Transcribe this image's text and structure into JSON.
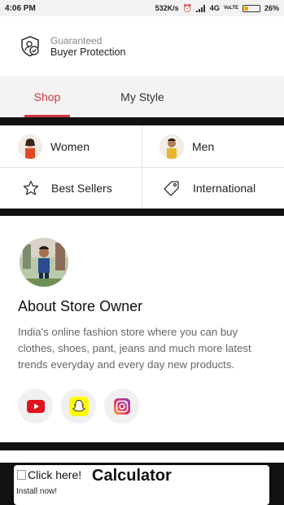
{
  "statusbar": {
    "time": "4:06 PM",
    "speed": "532K/s",
    "network": "4G",
    "volte": "VoLTE",
    "battery": "26%",
    "battery_level": 0.26
  },
  "protection": {
    "line1": "Guaranteed",
    "line2": "Buyer Protection"
  },
  "tabs": [
    {
      "label": "Shop",
      "active": true
    },
    {
      "label": "My Style",
      "active": false
    }
  ],
  "categories": {
    "women": "Women",
    "men": "Men",
    "best_sellers": "Best Sellers",
    "international": "International"
  },
  "about": {
    "title": "About Store Owner",
    "description": "India's online fashion store where you can buy clothes, shoes, pant, jeans and much more latest trends everyday and every day new products."
  },
  "socials": [
    {
      "icon": "youtube-icon",
      "color": "#e0121b"
    },
    {
      "icon": "snapchat-icon",
      "color": "#fffc00"
    },
    {
      "icon": "instagram-icon",
      "color": "#c13584"
    }
  ],
  "ad": {
    "img_alt": "Click here!",
    "title": "Calculator",
    "install": "Install now!"
  },
  "colors": {
    "accent": "#d03541"
  }
}
